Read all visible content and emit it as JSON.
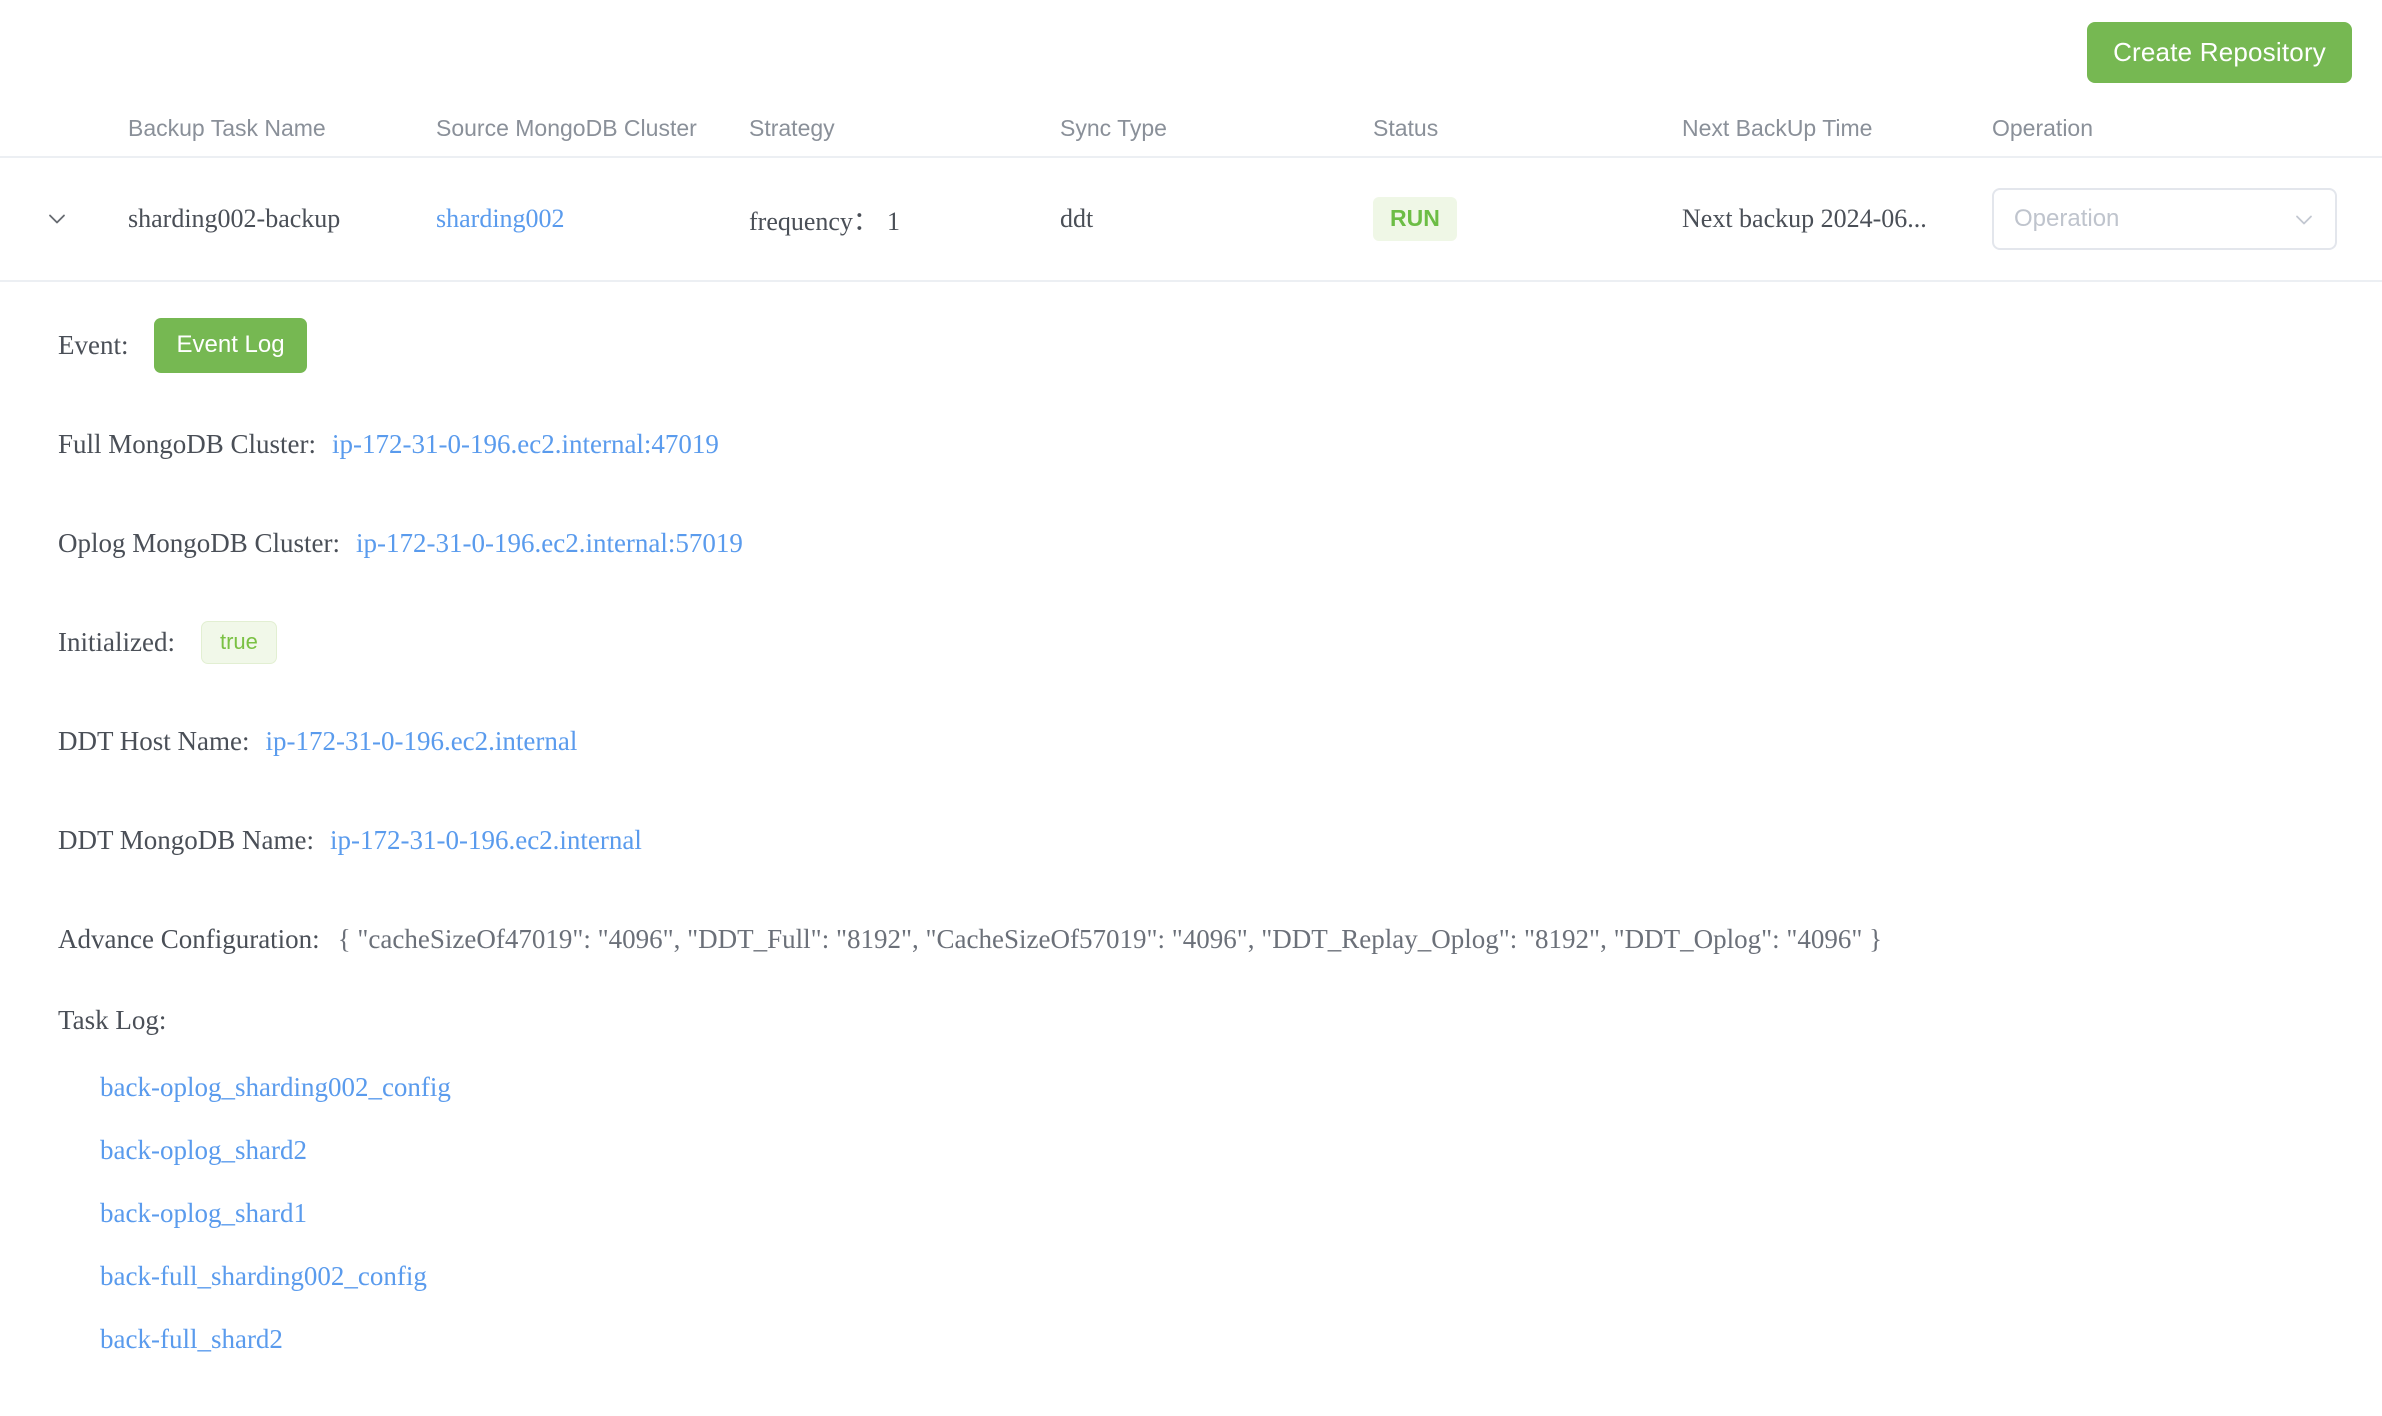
{
  "toolbar": {
    "create_repository_label": "Create Repository"
  },
  "table": {
    "columns": [
      {
        "key": "expand",
        "label": ""
      },
      {
        "key": "name",
        "label": "Backup Task Name"
      },
      {
        "key": "source",
        "label": "Source MongoDB Cluster"
      },
      {
        "key": "strategy",
        "label": "Strategy"
      },
      {
        "key": "sync_type",
        "label": "Sync Type"
      },
      {
        "key": "status",
        "label": "Status"
      },
      {
        "key": "next_backup",
        "label": "Next BackUp Time"
      },
      {
        "key": "operation",
        "label": "Operation"
      }
    ],
    "rows": [
      {
        "expand_icon": "chevron-down-icon",
        "name": "sharding002-backup",
        "source": "sharding002",
        "strategy_label": "frequency：",
        "strategy_value": "1",
        "sync_type": "ddt",
        "status": "RUN",
        "next_backup": "Next backup 2024-06...",
        "operation_placeholder": "Operation",
        "operation_icon": "chevron-down-icon"
      }
    ]
  },
  "detail": {
    "event": {
      "label": "Event:",
      "button_label": "Event Log"
    },
    "full_cluster": {
      "label": "Full MongoDB Cluster:",
      "value": "ip-172-31-0-196.ec2.internal:47019"
    },
    "oplog_cluster": {
      "label": "Oplog MongoDB Cluster:",
      "value": "ip-172-31-0-196.ec2.internal:57019"
    },
    "initialized": {
      "label": "Initialized:",
      "value": "true"
    },
    "ddt_host_name": {
      "label": "DDT Host Name:",
      "value": "ip-172-31-0-196.ec2.internal"
    },
    "ddt_mongodb_name": {
      "label": "DDT MongoDB Name:",
      "value": "ip-172-31-0-196.ec2.internal"
    },
    "advance_configuration": {
      "label": "Advance Configuration:",
      "value": "{ \"cacheSizeOf47019\": \"4096\", \"DDT_Full\": \"8192\", \"CacheSizeOf57019\": \"4096\", \"DDT_Replay_Oplog\": \"8192\", \"DDT_Oplog\": \"4096\" }"
    },
    "task_log": {
      "label": "Task Log:",
      "items": [
        "back-oplog_sharding002_config",
        "back-oplog_shard2",
        "back-oplog_shard1",
        "back-full_sharding002_config",
        "back-full_shard2"
      ]
    }
  },
  "colors": {
    "primary_green": "#76b852",
    "status_green": "#6cbd45",
    "status_green_bg": "#eff7e6",
    "link_blue": "#5a9bed",
    "header_gray": "#8a9099",
    "divider": "#eceff3"
  }
}
